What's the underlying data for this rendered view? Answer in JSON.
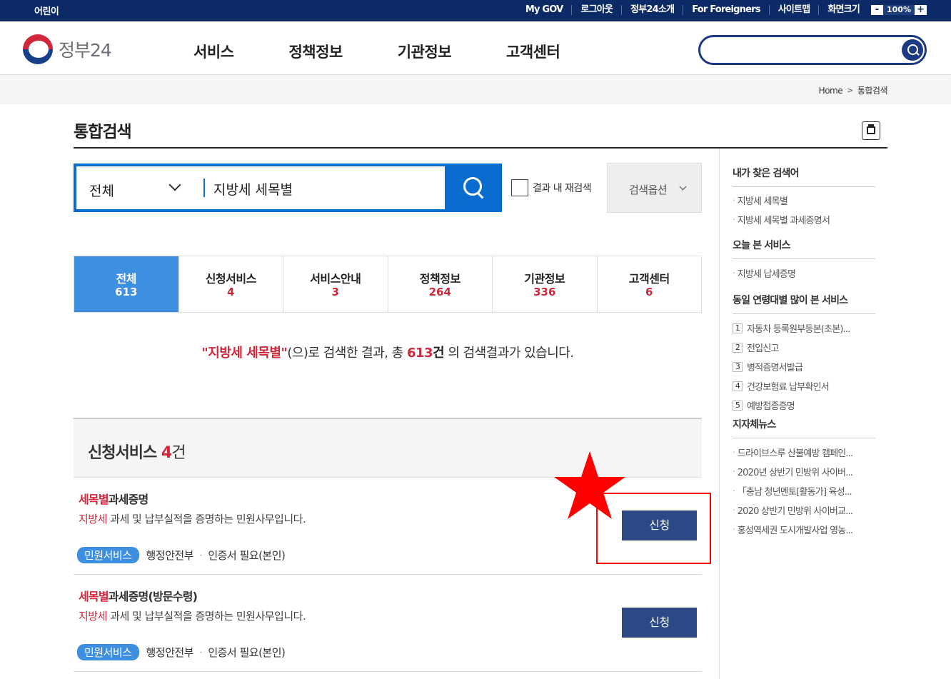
{
  "topbar": {
    "kids": "어린이",
    "links": [
      "My GOV",
      "로그아웃",
      "정부24소개",
      "For Foreigners",
      "사이트맵",
      "화면크기"
    ],
    "zoom_minus": "-",
    "zoom_value": "100%",
    "zoom_plus": "+"
  },
  "header": {
    "logo_text": "정부24",
    "menu": [
      "서비스",
      "정책정보",
      "기관정보",
      "고객센터"
    ],
    "search_placeholder": ""
  },
  "breadcrumb": {
    "home": "Home",
    "sep": ">",
    "current": "통합검색"
  },
  "page_title": "통합검색",
  "search": {
    "category": "전체",
    "query": "지방세 세목별",
    "recheck_label": "결과 내 재검색",
    "options_label": "검색옵션"
  },
  "tabs": [
    {
      "label": "전체",
      "count": "613"
    },
    {
      "label": "신청서비스",
      "count": "4"
    },
    {
      "label": "서비스안내",
      "count": "3"
    },
    {
      "label": "정책정보",
      "count": "264"
    },
    {
      "label": "기관정보",
      "count": "336"
    },
    {
      "label": "고객센터",
      "count": "6"
    }
  ],
  "summary": {
    "quote_open": "\"",
    "keyword": "지방세 세목별",
    "quote_close": "\"",
    "text1": "(으)로 검색한 결과, 총 ",
    "count": "613",
    "unit": "건",
    "text2": " 의 검색결과가 있습니다."
  },
  "section": {
    "title": "신청서비스 ",
    "count": "4",
    "unit": "건"
  },
  "results": [
    {
      "title_hl": "세목별",
      "title_rest": "과세증명",
      "desc_hl": "지방세",
      "desc_rest": " 과세 및 납부실적을 증명하는 민원사무입니다.",
      "badge": "민원서비스",
      "agency": "행정안전부",
      "dot": "·",
      "cert": "인증서 필요(본인)",
      "button": "신청"
    },
    {
      "title_hl": "세목별",
      "title_rest": "과세증명(방문수령)",
      "desc_hl": "지방세",
      "desc_rest": " 과세 및 납부실적을 증명하는 민원사무입니다.",
      "badge": "민원서비스",
      "agency": "행정안전부",
      "dot": "·",
      "cert": "인증서 필요(본인)",
      "button": "신청"
    }
  ],
  "sidebar": {
    "my_searches": {
      "title": "내가 찾은 검색어",
      "items": [
        "지방세 세목별",
        "지방세 세목별 과세증명서"
      ]
    },
    "today_services": {
      "title": "오늘 본 서비스",
      "items": [
        "지방세 납세증명"
      ]
    },
    "popular": {
      "title": "동일 연령대별 많이 본 서비스",
      "items": [
        {
          "num": "1",
          "label": "자동차 등록원부등본(초본)..."
        },
        {
          "num": "2",
          "label": "전입신고"
        },
        {
          "num": "3",
          "label": "병적증명서발급"
        },
        {
          "num": "4",
          "label": "건강보험료 납부확인서"
        },
        {
          "num": "5",
          "label": "예방접종증명"
        }
      ]
    },
    "local_news": {
      "title": "지자체뉴스",
      "items": [
        "드라이브스루 산불예방 캠페인...",
        "2020년 상반기 민방위 사이버...",
        "「충남 청년멘토[활동가] 육성...",
        "2020 상반기 민방위 사이버교...",
        "홍성역세권 도시개발사업 영농..."
      ]
    },
    "bullet": "·"
  },
  "colors": {
    "navy": "#0c2a66",
    "accent_blue": "#0a6ccf",
    "tab_active": "#3e8fe0",
    "highlight_red": "#d0283a",
    "apply_button": "#2b4a85",
    "annotation_red": "#ff0000"
  }
}
